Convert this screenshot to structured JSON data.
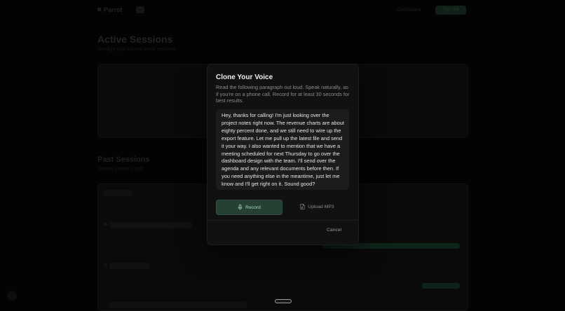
{
  "background": {
    "brand_name": "Parrot",
    "nav_links": [
      "Dashboard",
      "Sign Out"
    ],
    "page_title": "Active Sessions",
    "page_subtitle": "Manage your current voice sessions",
    "section_title": "Past Sessions",
    "section_subtitle": "Review previous calls"
  },
  "modal": {
    "title": "Clone Your Voice",
    "description": "Read the following paragraph out loud. Speak naturally, as if you're on a phone call. Record for at least 30 seconds for best results.",
    "script_text": "Hey, thanks for calling! I'm just looking over the project notes right now. The revenue charts are about eighty percent done, and we still need to wire up the export feature. Let me pull up the latest file and send it your way. I also wanted to mention that we have a meeting scheduled for next Thursday to go over the dashboard design with the team. I'll send over the agenda and any relevant documents before then. If you need anything else in the meantime, just let me know and I'll get right on it. Sound good?",
    "record_label": "Record",
    "upload_label": "Upload MP3",
    "cancel_label": "Cancel"
  },
  "colors": {
    "overlay": "#030303",
    "modal_bg": "#111111",
    "script_bg": "#1c1c1c",
    "accent_green": "#264034",
    "accent_green_text": "#9fdcb9"
  },
  "icons": {
    "record": "microphone-icon",
    "upload": "file-audio-icon"
  }
}
